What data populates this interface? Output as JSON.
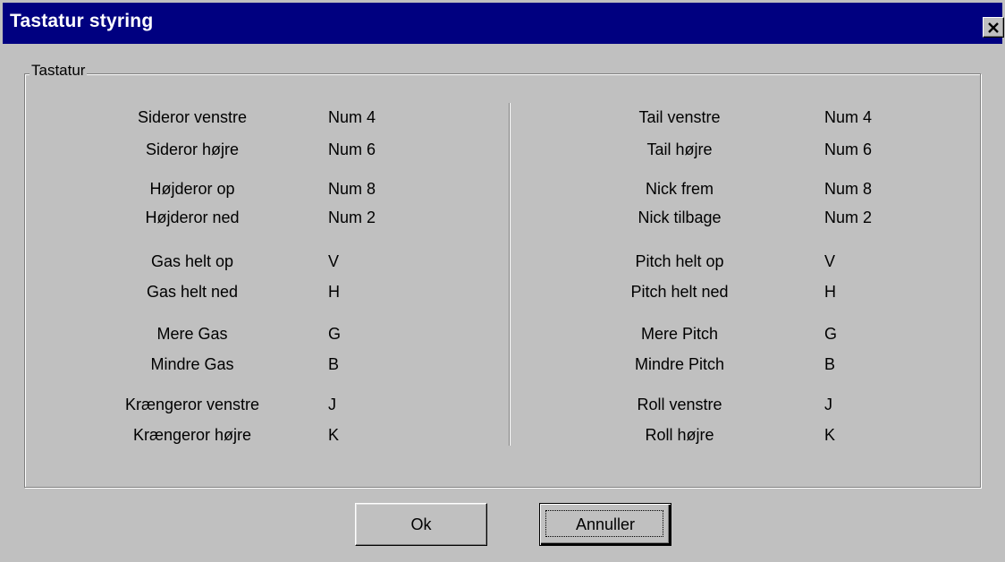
{
  "window": {
    "title": "Tastatur styring"
  },
  "group": {
    "legend": "Tastatur"
  },
  "left_rows": [
    {
      "label": "Sideror venstre",
      "key": "Num 4"
    },
    {
      "label": "Sideror højre",
      "key": "Num 6"
    },
    {
      "label": "Højderor op",
      "key": "Num 8"
    },
    {
      "label": "Højderor ned",
      "key": "Num 2"
    },
    {
      "label": "Gas helt op",
      "key": "V"
    },
    {
      "label": "Gas helt ned",
      "key": "H"
    },
    {
      "label": "Mere Gas",
      "key": "G"
    },
    {
      "label": "Mindre Gas",
      "key": "B"
    },
    {
      "label": "Krængeror venstre",
      "key": "J"
    },
    {
      "label": "Krængeror højre",
      "key": "K"
    }
  ],
  "right_rows": [
    {
      "label": "Tail venstre",
      "key": "Num 4"
    },
    {
      "label": "Tail højre",
      "key": "Num 6"
    },
    {
      "label": "Nick frem",
      "key": "Num 8"
    },
    {
      "label": "Nick tilbage",
      "key": "Num 2"
    },
    {
      "label": "Pitch helt op",
      "key": "V"
    },
    {
      "label": "Pitch helt ned",
      "key": "H"
    },
    {
      "label": "Mere Pitch",
      "key": "G"
    },
    {
      "label": "Mindre Pitch",
      "key": "B"
    },
    {
      "label": "Roll venstre",
      "key": "J"
    },
    {
      "label": "Roll højre",
      "key": "K"
    }
  ],
  "buttons": {
    "ok_label": "Ok",
    "cancel_label": "Annuller"
  },
  "icons": {
    "close": "close-icon"
  },
  "colors": {
    "titlebar": "#000080",
    "face": "#c0c0c0"
  }
}
